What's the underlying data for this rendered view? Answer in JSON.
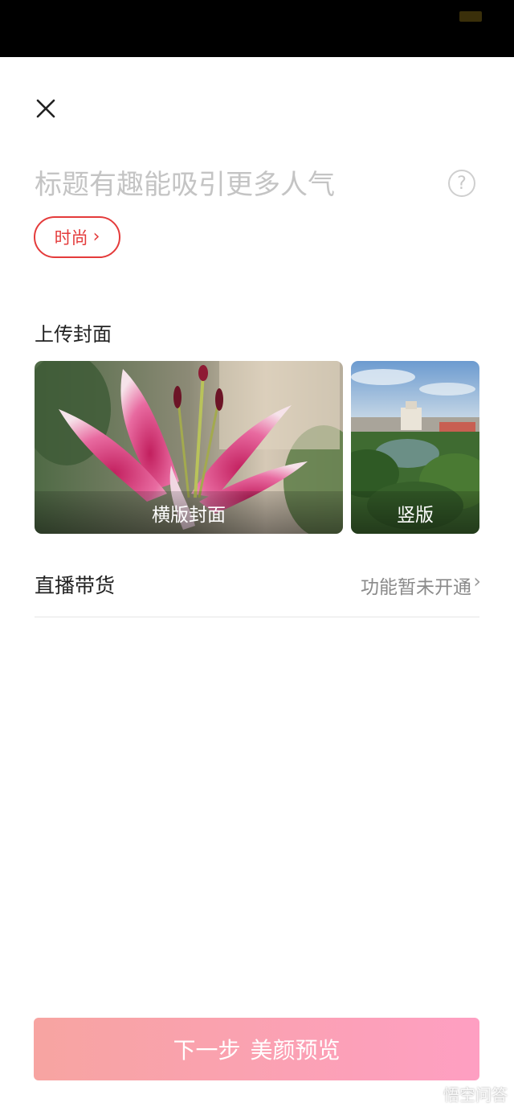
{
  "header": {
    "close_icon": "close-icon"
  },
  "title": {
    "placeholder": "标题有趣能吸引更多人气",
    "help_icon": "?"
  },
  "category": {
    "label": "时尚",
    "chevron": "›"
  },
  "cover": {
    "heading": "上传封面",
    "landscape_label": "横版封面",
    "portrait_label": "竖版"
  },
  "live_commerce": {
    "label": "直播带货",
    "value": "功能暂未开通",
    "chevron": "›"
  },
  "next_button": {
    "label_left": "下一步",
    "label_right": "美颜预览"
  },
  "watermark": {
    "text": "悟空问答"
  },
  "colors": {
    "accent": "#e43b3b",
    "button_gradient_start": "#f7a4a1",
    "button_gradient_end": "#fe9fc2"
  }
}
